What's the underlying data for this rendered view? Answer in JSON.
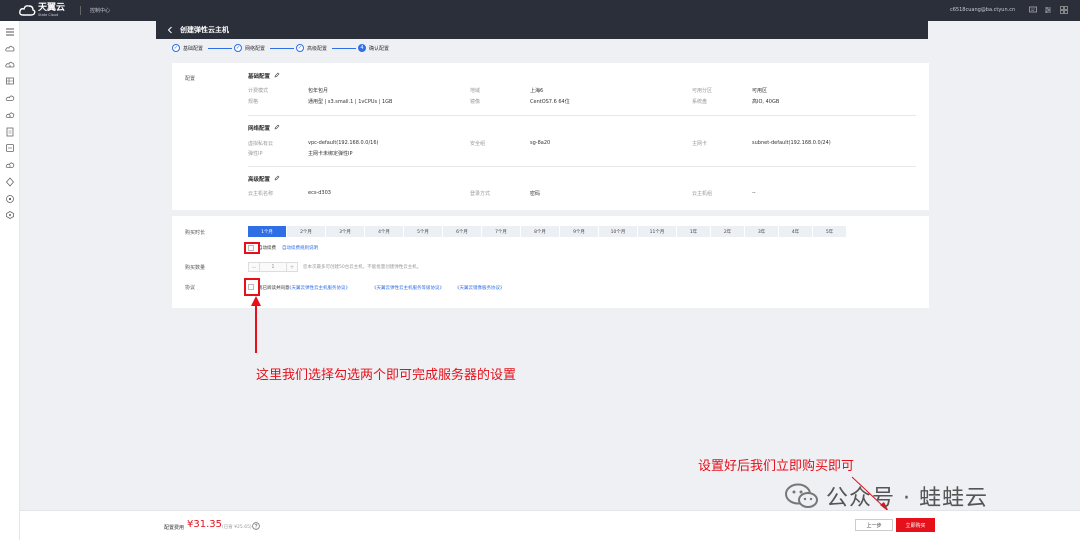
{
  "topbar": {
    "logo_name": "天翼云",
    "logo_sub": "State Cloud",
    "console": "控制中心",
    "user_email": "c6518cuang@ba.ctyun.cn"
  },
  "header": {
    "title": "创建弹性云主机"
  },
  "steps": [
    {
      "label": "基础配置",
      "mark": "✓"
    },
    {
      "label": "网络配置",
      "mark": "✓"
    },
    {
      "label": "高级配置",
      "mark": "✓"
    },
    {
      "label": "确认配置",
      "mark": "4"
    }
  ],
  "config": {
    "side_label": "配置",
    "basic": {
      "title": "基础配置",
      "rows": [
        [
          {
            "k": "计费模式",
            "v": "包年包月"
          },
          {
            "k": "地域",
            "v": "上海6"
          },
          {
            "k": "可用分区",
            "v": "可用区"
          }
        ],
        [
          {
            "k": "规格",
            "v": "通用型 | s3.small.1 | 1vCPUs | 1GB"
          },
          {
            "k": "镜像",
            "v": "CentOS7.6 64位"
          },
          {
            "k": "系统盘",
            "v": "高IO, 40GB"
          }
        ]
      ]
    },
    "network": {
      "title": "网络配置",
      "rows": [
        [
          {
            "k": "虚拟私有云",
            "v": "vpc-default(192.168.0.0/16)"
          },
          {
            "k": "安全组",
            "v": "sg-8a20"
          },
          {
            "k": "主网卡",
            "v": "subnet-default(192.168.0.0/24)"
          }
        ],
        [
          {
            "k": "弹性IP",
            "v": "主网卡未绑定弹性IP"
          }
        ]
      ]
    },
    "advanced": {
      "title": "高级配置",
      "rows": [
        [
          {
            "k": "云主机名称",
            "v": "ecs-d303"
          },
          {
            "k": "登录方式",
            "v": "密码"
          },
          {
            "k": "云主机组",
            "v": "--"
          }
        ]
      ]
    }
  },
  "purchase": {
    "duration_label": "购买时长",
    "durations": [
      "1个月",
      "2个月",
      "3个月",
      "4个月",
      "5个月",
      "6个月",
      "7个月",
      "8个月",
      "9个月",
      "10个月",
      "11个月",
      "1年",
      "2年",
      "3年",
      "4年",
      "5年"
    ],
    "selected_duration": "1个月",
    "auto_renew_text": "自动续费",
    "renew_link": "自动续费规则说明",
    "quantity_label": "购买数量",
    "quantity": "1",
    "quantity_hint": "您本次最多可创建50台云主机，不能批量创建弹性云主机。",
    "agreement_label": "协议",
    "agreement_text": "我已阅读并同意",
    "agreements": [
      "《天翼云弹性云主机服务协议》",
      "《天翼云弹性云主机服务等级协议》",
      "《天翼云镜像服务协议》"
    ]
  },
  "annotations": {
    "a1": "这里我们选择勾选两个即可完成服务器的设置",
    "a2": "设置好后我们立即购买即可",
    "watermark": "公众号 · 蛙蛙云"
  },
  "footer": {
    "fee_label": "配置费用",
    "fee_value": "¥31.35",
    "fee_saved": "(已省 ¥25.65)",
    "prev": "上一步",
    "buy": "立即购买"
  },
  "colors": {
    "accent": "#2f6fe6",
    "danger": "#e5101a",
    "dark": "#2b2f3a"
  }
}
